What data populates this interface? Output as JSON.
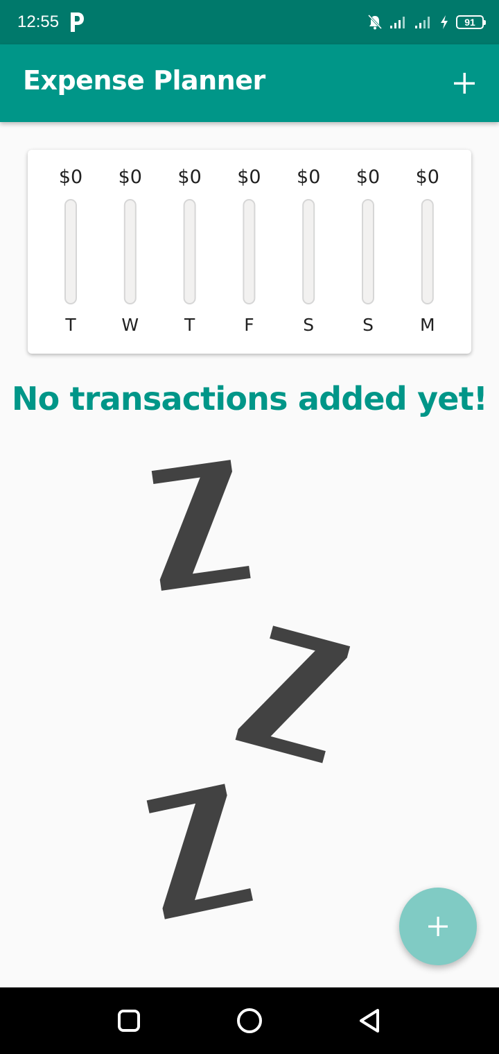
{
  "status_bar": {
    "time": "12:55",
    "battery": "91",
    "icons": [
      "parking-app-icon",
      "bell-off-icon",
      "signal-icon",
      "signal-icon",
      "charging-icon",
      "battery-icon"
    ]
  },
  "app_bar": {
    "title": "Expense Planner",
    "add_icon": "plus-icon",
    "color": "#009688"
  },
  "chart_data": {
    "type": "bar",
    "categories": [
      "T",
      "W",
      "T",
      "F",
      "S",
      "S",
      "M"
    ],
    "value_labels": [
      "$0",
      "$0",
      "$0",
      "$0",
      "$0",
      "$0",
      "$0"
    ],
    "values": [
      0,
      0,
      0,
      0,
      0,
      0,
      0
    ],
    "title": "",
    "xlabel": "",
    "ylabel": ""
  },
  "empty_state": {
    "message": "No transactions added yet!",
    "illustration": "zzz-sleep-image"
  },
  "fab": {
    "icon": "plus-icon",
    "color": "#80cbc4"
  },
  "nav_bar": {
    "buttons": [
      "recents-square-icon",
      "home-circle-icon",
      "back-triangle-icon"
    ]
  },
  "colors": {
    "primary": "#009688",
    "primary_dark": "#00796b",
    "accent": "#80cbc4"
  }
}
